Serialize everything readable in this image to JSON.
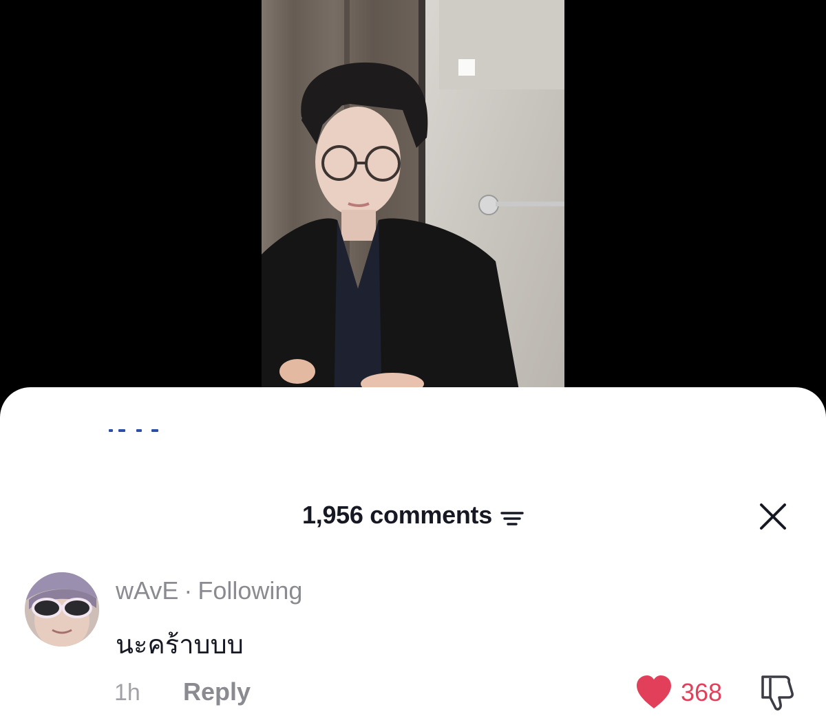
{
  "sheet": {
    "comments_count": "1,956 comments",
    "sort_icon": "sort-icon",
    "close_icon": "close-icon"
  },
  "comment": {
    "username": "wAvE",
    "separator": "·",
    "relation": "Following",
    "text": "นะคร้าบบบ",
    "time": "1h",
    "reply_label": "Reply",
    "like_count": "368",
    "like_icon": "heart-icon",
    "dislike_icon": "thumbs-down-icon"
  },
  "colors": {
    "accent_like": "#e2405a",
    "text_primary": "#161823",
    "text_secondary": "#8a8b91",
    "background": "#ffffff",
    "video_letterbox": "#000000"
  }
}
